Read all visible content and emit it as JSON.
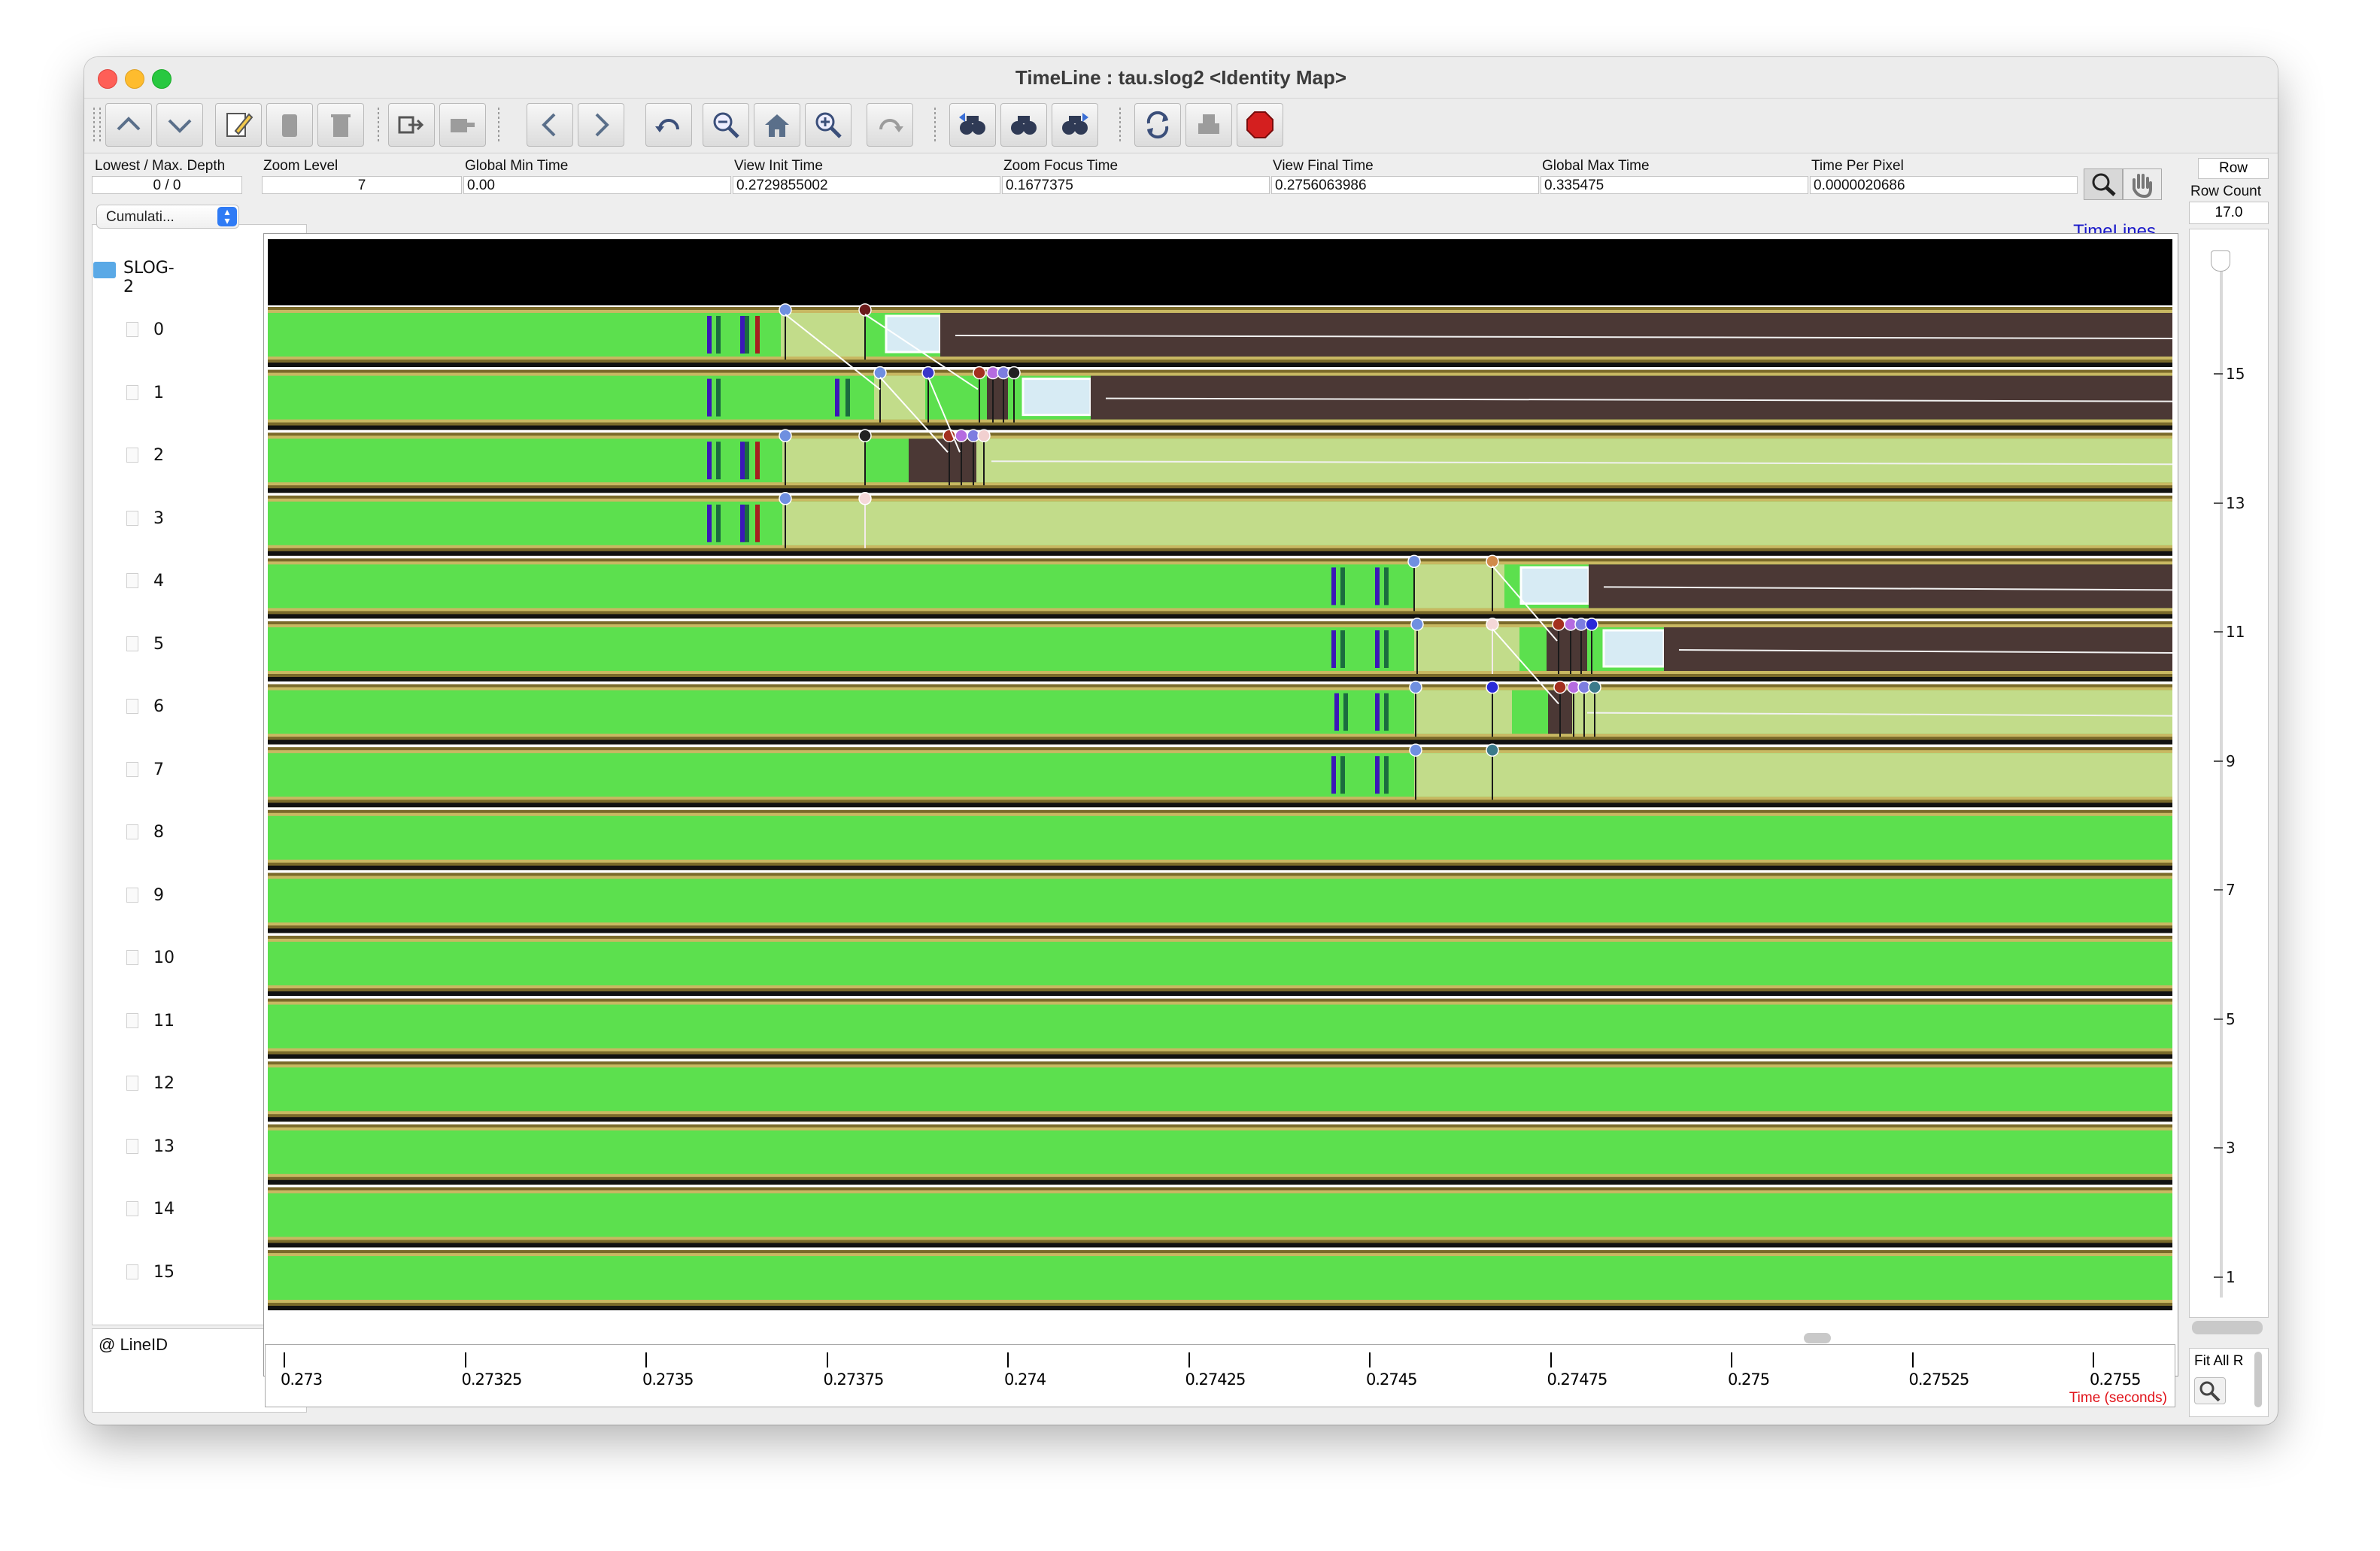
{
  "window": {
    "title": "TimeLine : tau.slog2  <Identity Map>"
  },
  "toolbar": {
    "buttons": [
      {
        "name": "scroll-up-icon"
      },
      {
        "name": "scroll-down-icon"
      },
      {
        "name": "edit-icon"
      },
      {
        "name": "paste-icon"
      },
      {
        "name": "delete-icon"
      },
      {
        "name": "expand-icon"
      },
      {
        "name": "collapse-icon"
      },
      {
        "name": "back-icon"
      },
      {
        "name": "forward-icon"
      },
      {
        "name": "undo-zoom-icon"
      },
      {
        "name": "zoom-out-icon"
      },
      {
        "name": "zoom-home-icon"
      },
      {
        "name": "zoom-in-icon"
      },
      {
        "name": "redo-zoom-icon"
      },
      {
        "name": "search-backward-icon"
      },
      {
        "name": "search-init-icon"
      },
      {
        "name": "search-forward-icon"
      },
      {
        "name": "refresh-icon"
      },
      {
        "name": "print-icon"
      },
      {
        "name": "stop-icon"
      }
    ]
  },
  "info": {
    "depth_label": "Lowest / Max. Depth",
    "depth_value": "0 / 0",
    "fields": [
      {
        "label": "Zoom Level",
        "value": "7",
        "align": "center"
      },
      {
        "label": "Global Min Time",
        "value": "0.00",
        "align": "left"
      },
      {
        "label": "View  Init Time",
        "value": "0.2729855002",
        "align": "left"
      },
      {
        "label": "Zoom Focus Time",
        "value": "0.1677375",
        "align": "left"
      },
      {
        "label": "View Final Time",
        "value": "0.2756063986",
        "align": "left"
      },
      {
        "label": "Global Max Time",
        "value": "0.335475",
        "align": "left"
      },
      {
        "label": "Time Per Pixel",
        "value": "0.0000020686",
        "align": "left"
      }
    ]
  },
  "left": {
    "select_value": "Cumulati...",
    "root_label": "SLOG-2",
    "lines": [
      "0",
      "1",
      "2",
      "3",
      "4",
      "5",
      "6",
      "7",
      "8",
      "9",
      "10",
      "11",
      "12",
      "13",
      "14",
      "15"
    ],
    "lineid_label": "@ LineID"
  },
  "canvas": {
    "title": "TimeLines",
    "x_axis_label": "Time (seconds)",
    "ticks": [
      "0.273",
      "0.27325",
      "0.2735",
      "0.27375",
      "0.274",
      "0.27425",
      "0.2745",
      "0.27475",
      "0.275",
      "0.27525",
      "0.2755"
    ]
  },
  "right": {
    "row_label": "Row",
    "row_count_label": "Row Count",
    "row_count_value": "17.0",
    "scale_ticks": [
      "15",
      "13",
      "11",
      "9",
      "7",
      "5",
      "3",
      "1"
    ],
    "fit_label": "Fit All R"
  },
  "colors": {
    "state_green": "#5ce04e",
    "dark_brown": "#4b3835",
    "light_olive": "#c2dc8a",
    "light_blue": "#d7ebf4",
    "timeline_title": "#1a19c9",
    "axis_label_red": "#e1141b"
  }
}
